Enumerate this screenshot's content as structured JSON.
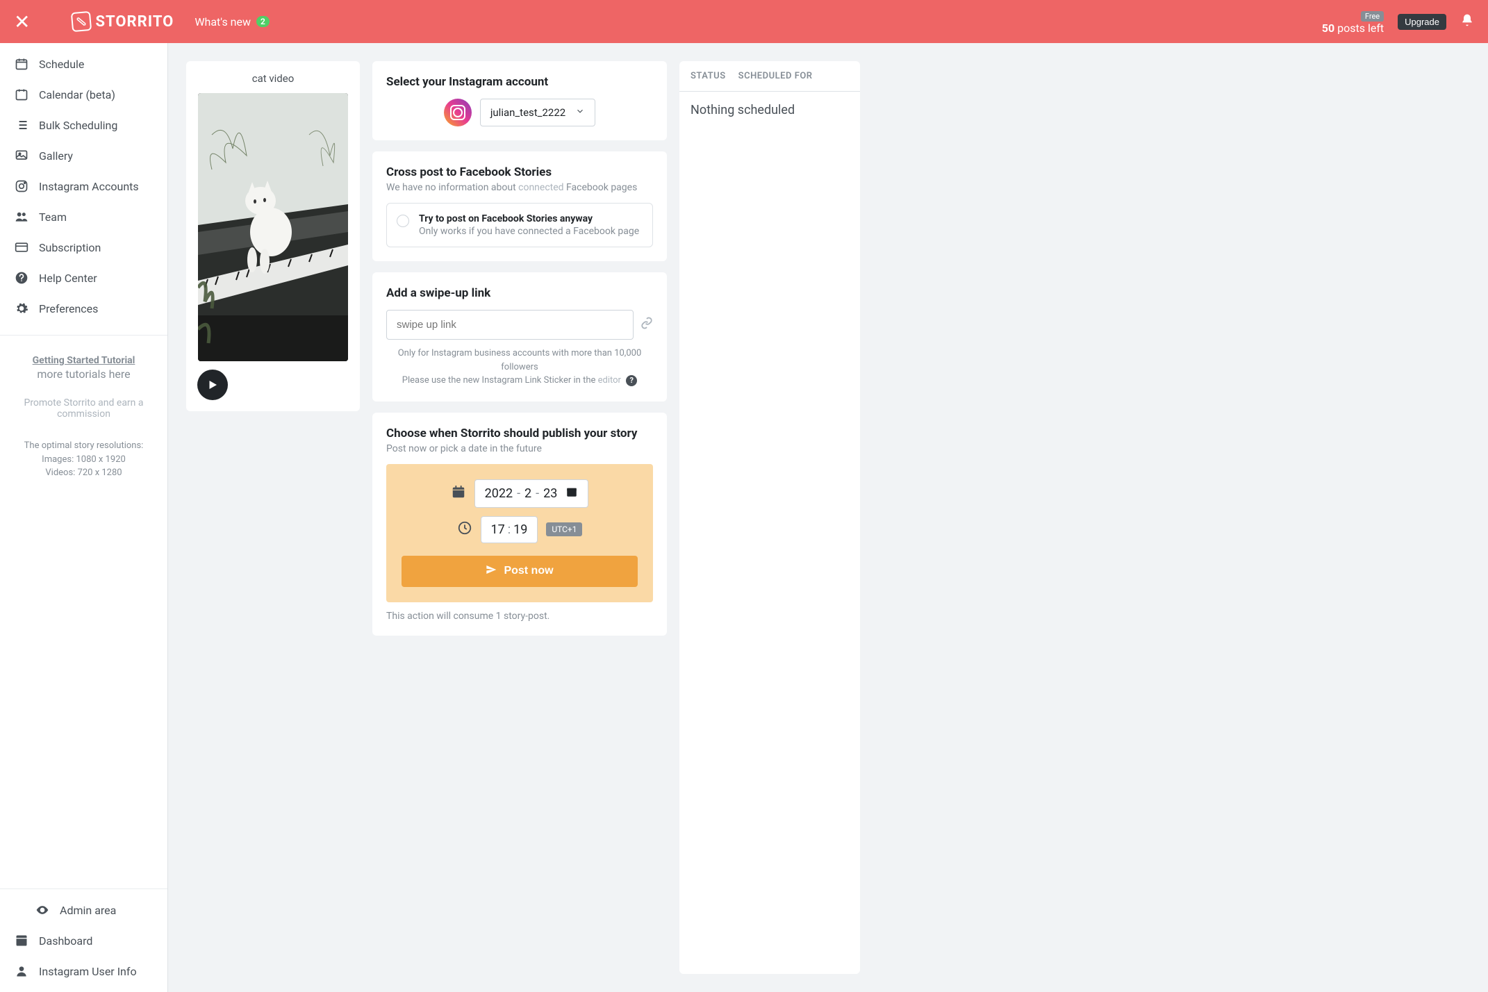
{
  "header": {
    "logo_text": "STORRITO",
    "whats_new": "What's new",
    "whats_new_badge": "2",
    "free_badge": "Free",
    "posts_left_num": "50",
    "posts_left_text": " posts left",
    "upgrade": "Upgrade"
  },
  "sidebar": {
    "items": [
      {
        "label": "Schedule"
      },
      {
        "label": "Calendar (beta)"
      },
      {
        "label": "Bulk Scheduling"
      },
      {
        "label": "Gallery"
      },
      {
        "label": "Instagram Accounts"
      },
      {
        "label": "Team"
      },
      {
        "label": "Subscription"
      },
      {
        "label": "Help Center"
      },
      {
        "label": "Preferences"
      }
    ],
    "tutorial_link": "Getting Started Tutorial",
    "more_tutorials": "more tutorials here",
    "promote": "Promote Storrito and earn a commission",
    "resolutions_title": "The optimal story resolutions:",
    "resolutions_images": "Images: 1080 x 1920",
    "resolutions_videos": "Videos: 720 x 1280",
    "bottom_items": [
      {
        "label": "Admin area"
      },
      {
        "label": "Dashboard"
      },
      {
        "label": "Instagram User Info"
      }
    ]
  },
  "preview": {
    "title": "cat video"
  },
  "account_card": {
    "title": "Select your Instagram account",
    "selected": "julian_test_2222"
  },
  "crosspost_card": {
    "title": "Cross post to Facebook Stories",
    "subtitle_a": "We have no information about ",
    "subtitle_b": "connected",
    "subtitle_c": " Facebook pages",
    "option_title": "Try to post on Facebook Stories anyway",
    "option_sub": "Only works if you have connected a Facebook page"
  },
  "swipe_card": {
    "title": "Add a swipe-up link",
    "placeholder": "swipe up link",
    "hint1": "Only for Instagram business accounts with more than 10,000 followers",
    "hint2a": "Please use the new Instagram Link Sticker in the ",
    "hint2b": "editor"
  },
  "schedule_card": {
    "title": "Choose when Storrito should publish your story",
    "subtitle": "Post now or pick a date in the future",
    "year": "2022",
    "month": "2",
    "day": "23",
    "hour": "17",
    "minute": "19",
    "tz": "UTC+1",
    "post_now": "Post now",
    "consume": "This action will consume 1 story-post."
  },
  "right": {
    "tab1": "STATUS",
    "tab2": "SCHEDULED FOR",
    "nothing": "Nothing scheduled"
  }
}
